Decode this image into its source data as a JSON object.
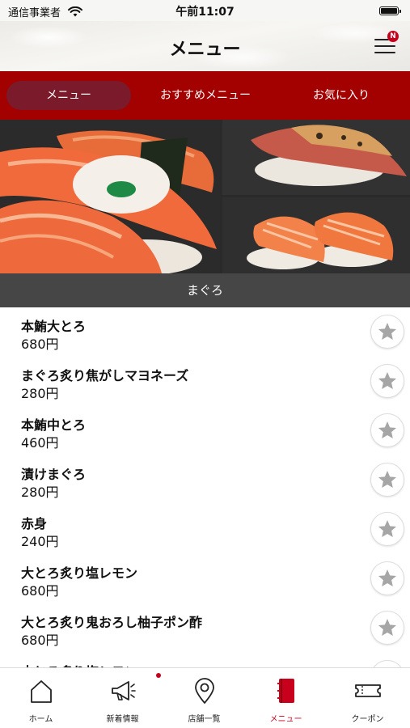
{
  "status_bar": {
    "carrier": "通信事業者",
    "time": "午前11:07"
  },
  "header": {
    "title": "メニュー",
    "notification_badge": "N"
  },
  "tabs": [
    {
      "label": "メニュー",
      "active": true
    },
    {
      "label": "おすすめメニュー",
      "active": false
    },
    {
      "label": "お気に入り",
      "active": false
    }
  ],
  "category": "まぐろ",
  "items": [
    {
      "name": "本鮪大とろ",
      "price": "680円"
    },
    {
      "name": "まぐろ炙り焦がしマヨネーズ",
      "price": "280円"
    },
    {
      "name": "本鮪中とろ",
      "price": "460円"
    },
    {
      "name": "漬けまぐろ",
      "price": "280円"
    },
    {
      "name": "赤身",
      "price": "240円"
    },
    {
      "name": "大とろ炙り塩レモン",
      "price": "680円"
    },
    {
      "name": "大とろ炙り鬼おろし柚子ポン酢",
      "price": "680円"
    },
    {
      "name": "中とろ炙り塩レモン",
      "price": ""
    }
  ],
  "bottom_nav": [
    {
      "label": "ホーム",
      "icon": "home-icon",
      "active": false
    },
    {
      "label": "新着情報",
      "icon": "megaphone-icon",
      "active": false,
      "has_dot": true
    },
    {
      "label": "店舗一覧",
      "icon": "map-pin-icon",
      "active": false
    },
    {
      "label": "メニュー",
      "icon": "menu-book-icon",
      "active": true
    },
    {
      "label": "クーポン",
      "icon": "ticket-icon",
      "active": false
    }
  ],
  "colors": {
    "brand_red": "#a30000",
    "active_tab": "#7a1a2a",
    "category_bar": "#464646",
    "accent": "#c8001c",
    "star": "#a6a6a6"
  }
}
